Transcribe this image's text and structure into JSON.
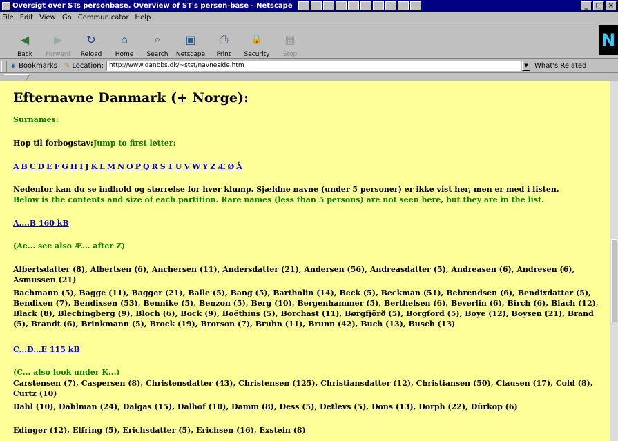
{
  "window": {
    "title": "Oversigt over STs personbase. Overview of ST's person-base - Netscape"
  },
  "menu": [
    "File",
    "Edit",
    "View",
    "Go",
    "Communicator",
    "Help"
  ],
  "toolbar": [
    {
      "label": "Back",
      "icon": "back-arrow-icon",
      "glyph": "◀",
      "disabled": false
    },
    {
      "label": "Forward",
      "icon": "forward-arrow-icon",
      "glyph": "▶",
      "disabled": true
    },
    {
      "label": "Reload",
      "icon": "reload-icon",
      "glyph": "↻",
      "disabled": false
    },
    {
      "label": "Home",
      "icon": "home-icon",
      "glyph": "⌂",
      "disabled": false
    },
    {
      "label": "Search",
      "icon": "search-icon",
      "glyph": "⌕",
      "disabled": false
    },
    {
      "label": "Netscape",
      "icon": "netscape-icon",
      "glyph": "▣",
      "disabled": false
    },
    {
      "label": "Print",
      "icon": "print-icon",
      "glyph": "⎙",
      "disabled": false
    },
    {
      "label": "Security",
      "icon": "lock-icon",
      "glyph": "🔒",
      "disabled": false
    },
    {
      "label": "Stop",
      "icon": "stop-icon",
      "glyph": "▦",
      "disabled": true
    }
  ],
  "location": {
    "bookmarks_label": "Bookmarks",
    "location_label": "Location:",
    "url": "http://www.danbbs.dk/~stst/navneside.htm",
    "related_label": "What's Related"
  },
  "page": {
    "heading": "Efternavne Danmark (+ Norge):",
    "surnames": "Surnames:",
    "jump_da": "Hop til forbogstav:",
    "jump_en": "Jump to first letter:",
    "letters": [
      "A",
      "B",
      "C",
      "D",
      "E",
      "F",
      "G",
      "H",
      "I",
      "J",
      "K",
      "L",
      "M",
      "N",
      "O",
      "P",
      "Q",
      "R",
      "S",
      "T",
      "U",
      "V",
      "W",
      "Y",
      "Z",
      "Æ",
      "Ø",
      "Å"
    ],
    "intro_da": "Nedenfor kan du se indhold og størrelse for hver klump. Sjældne navne (under 5 personer) er ikke vist her, men er med i listen.",
    "intro_en": "Below is the contents and size of each partition. Rare names (less than 5 persons) are not seen here, but they are in the list.",
    "section_ab": "A....B  160 kB",
    "note_ae": "(Ae... see also Æ... after Z)",
    "names_a": "Albertsdatter (8), Albertsen (6), Anchersen (11), Andersdatter (21), Andersen (56), Andreasdatter (5), Andreasen (6), Andresen (6), Asmussen (21)",
    "names_b": "Bachmann (5), Bagge (11), Bagger (21), Balle (5), Bang (5), Bartholin (14), Beck (5), Beckman (51), Behrendsen (6), Bendixdatter (5), Bendixen (7), Bendixsen (53), Bennike (5), Benzon (5), Berg (10), Bergenhammer (5), Berthelsen (6), Beverlin (6), Birch (6), Blach (12), Black (8), Blechingberg (9), Bloch (6), Bock (9), Boëthius (5), Borchast (11), Børgfjörð (5), Borgford (5), Boye (12), Boysen (21), Brand (5), Brandt (6), Brinkmann (5), Brock (19), Brorson (7), Bruhn (11), Brunn (42), Buch (13), Busch (13)",
    "section_cde": "C...D...E  115 kB",
    "note_c": "(C... also look under K...)",
    "names_c": "Carstensen (7), Caspersen (8), Christensdatter (43), Christensen (125), Christiansdatter (12), Christiansen (50), Clausen (17), Cold (8), Curtz (10)",
    "names_d": "Dahl (10), Dahlman (24), Dalgas (15), Dalhof (10), Damm (8), Dess (5), Detlevs (5), Dons (13), Dorph (22), Dürkop (6)",
    "names_e": "Edinger (12), Elfring (5), Erichsdatter (5), Erichsen (16), Exstein (8)"
  }
}
